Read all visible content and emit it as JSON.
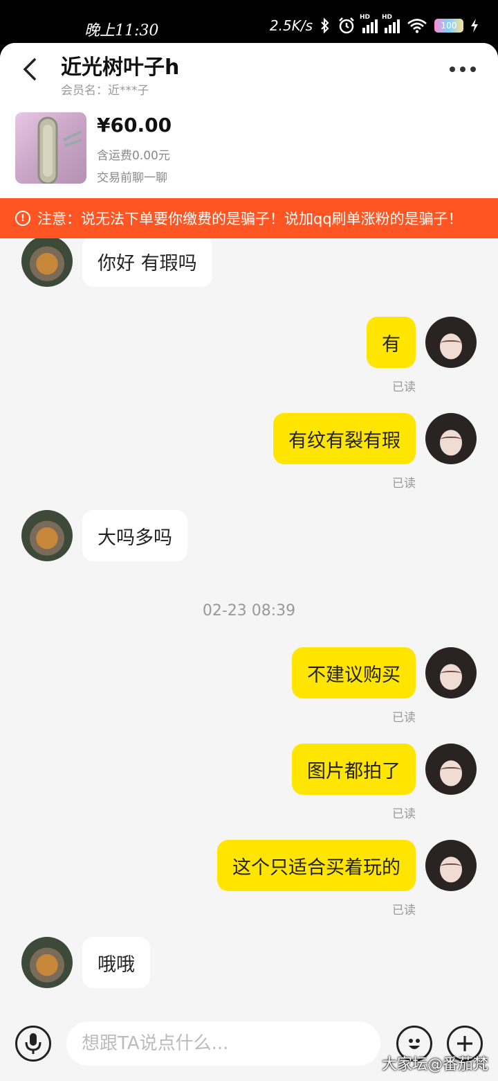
{
  "status_bar": {
    "time": "晚上11:30",
    "network_speed": "2.5K/s",
    "battery": "100",
    "icons": [
      "bluetooth-icon",
      "alarm-icon",
      "signal-hd-icon",
      "signal-hd-icon",
      "wifi-icon",
      "battery-icon",
      "charging-icon"
    ]
  },
  "header": {
    "title": "近光树叶子h",
    "member_label": "会员名：近***子",
    "back_icon": "chevron-left-icon",
    "more_icon": "more-horizontal-icon"
  },
  "product": {
    "price": "¥60.00",
    "shipping": "含运费0.00元",
    "chat_hint": "交易前聊一聊"
  },
  "warning": {
    "icon": "alert-circle-icon",
    "text": "注意：说无法下单要你缴费的是骗子！说加qq刷单涨粉的是骗子！",
    "bg_color": "#ff5522"
  },
  "messages": [
    {
      "side": "in",
      "text": "你好 有瑕吗"
    },
    {
      "side": "out",
      "text": "有",
      "status": "已读"
    },
    {
      "side": "out",
      "text": "有纹有裂有瑕",
      "status": "已读"
    },
    {
      "side": "in",
      "text": "大吗多吗"
    },
    {
      "side": "date",
      "text": "02-23 08:39"
    },
    {
      "side": "out",
      "text": "不建议购买",
      "status": "已读"
    },
    {
      "side": "out",
      "text": "图片都拍了",
      "status": "已读"
    },
    {
      "side": "out",
      "text": "这个只适合买着玩的",
      "status": "已读"
    },
    {
      "side": "in",
      "text": "哦哦"
    }
  ],
  "input": {
    "placeholder": "想跟TA说点什么...",
    "voice_icon": "microphone-icon",
    "emoji_icon": "emoji-icon",
    "plus_icon": "plus-circle-icon"
  },
  "colors": {
    "outgoing_bubble": "#ffe500",
    "incoming_bubble": "#ffffff",
    "chat_background": "#f5f5f5"
  },
  "watermark": "大家坛@番茄梵"
}
